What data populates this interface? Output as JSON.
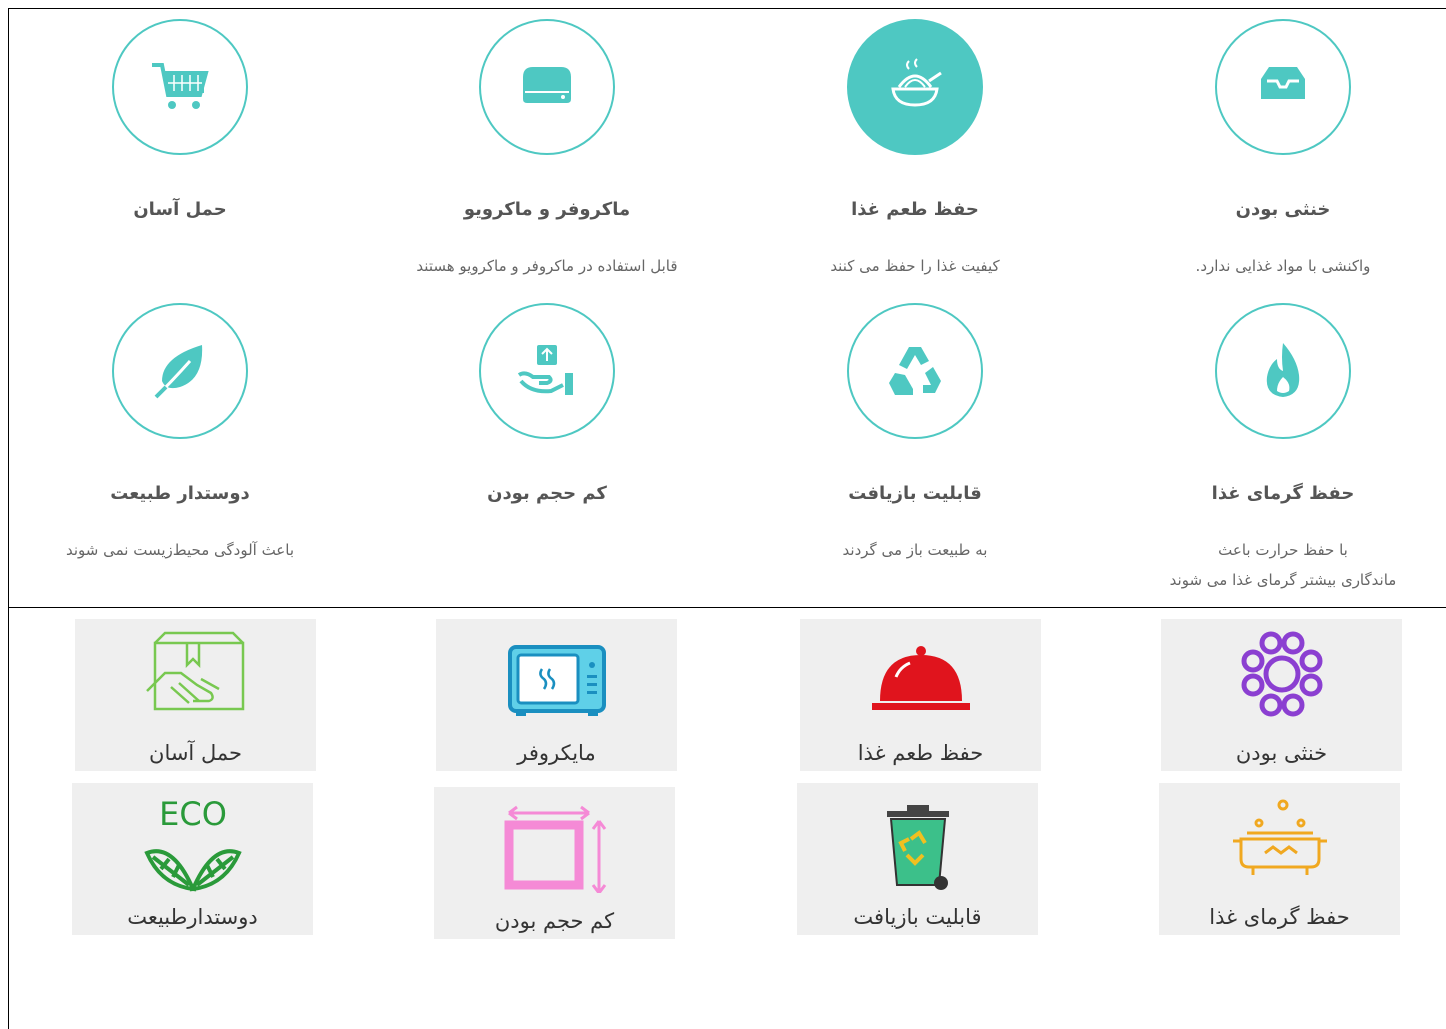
{
  "colors": {
    "accent": "#4ec8c2",
    "title_text": "#555555",
    "desc_text": "#666666",
    "tile_bg": "#efefef"
  },
  "features": [
    {
      "icon": "tray-icon",
      "title": "خنثی بودن",
      "desc": "واکنشی با مواد غذایی ندارد."
    },
    {
      "icon": "food-steam-icon",
      "title": "حفظ طعم غذا",
      "desc": "کیفیت غذا را حفظ می کنند"
    },
    {
      "icon": "microwave-icon",
      "title": "ماکروفر و ماکرویو",
      "desc": "قابل استفاده در ماکروفر و ماکرویو هستند"
    },
    {
      "icon": "cart-icon",
      "title": "حمل آسان",
      "desc": ""
    },
    {
      "icon": "fire-icon",
      "title": "حفظ گرمای غذا",
      "desc": "با حفظ حرارت باعث\nماندگاری بیشتر گرمای غذا می شوند"
    },
    {
      "icon": "recycle-icon",
      "title": "قابلیت بازیافت",
      "desc": "به طبیعت باز می گردند"
    },
    {
      "icon": "hand-box-icon",
      "title": "کم حجم بودن",
      "desc": ""
    },
    {
      "icon": "leaf-icon",
      "title": "دوستدار طبیعت",
      "desc": "باعث آلودگی محیط‌زیست نمی شوند"
    }
  ],
  "tiles": [
    {
      "icon": "molecule-icon",
      "label": "خنثی بودن",
      "color": "#8b3fd1"
    },
    {
      "icon": "cloche-icon",
      "label": "حفظ طعم غذا",
      "color": "#e0141d"
    },
    {
      "icon": "microwave-icon",
      "label": "مایکروفر",
      "color": "#1a8fc0"
    },
    {
      "icon": "box-handshake-icon",
      "label": "حمل آسان",
      "color": "#78c850"
    },
    {
      "icon": "cooking-pot-icon",
      "label": "حفظ گرمای غذا",
      "color": "#f0a820"
    },
    {
      "icon": "recycle-bin-icon",
      "label": "قابلیت بازیافت",
      "color": "#3cc08a"
    },
    {
      "icon": "resize-square-icon",
      "label": "کم حجم بودن",
      "color": "#f58ad6"
    },
    {
      "icon": "eco-leaves-icon",
      "label": "دوستدارطبیعت",
      "color": "#2a9a3a",
      "logo_text": "ECO"
    }
  ]
}
